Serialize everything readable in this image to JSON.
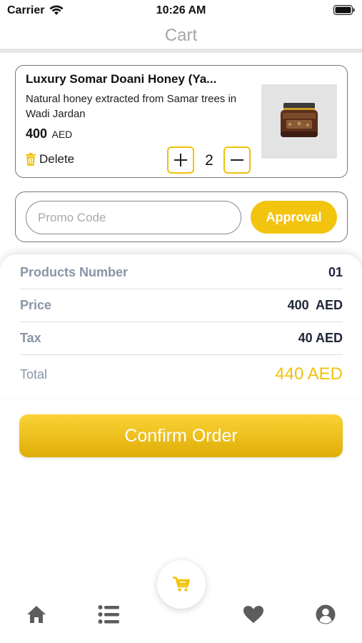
{
  "status_bar": {
    "carrier": "Carrier",
    "time": "10:26 AM"
  },
  "nav": {
    "title": "Cart"
  },
  "product": {
    "name": "Luxury Somar Doani Honey (Ya...",
    "description": "Natural honey extracted from Samar trees in Wadi Jardan",
    "price": "400",
    "currency": "AED",
    "delete_label": "Delete",
    "quantity": "2",
    "image_icon": "honey-jar"
  },
  "promo": {
    "placeholder": "Promo Code",
    "button_label": "Approval"
  },
  "summary": {
    "products_number_label": "Products Number",
    "products_number_value": "01",
    "price_label": "Price",
    "price_value": "400  AED",
    "tax_label": "Tax",
    "tax_value": "40 AED",
    "total_label": "Total",
    "total_value": "440 AED"
  },
  "confirm_button_label": "Confirm Order",
  "tab_bar": {
    "items": [
      "home-icon",
      "list-icon",
      "cart-icon",
      "heart-icon",
      "profile-icon"
    ]
  },
  "colors": {
    "accent": "#f2c40e",
    "label": "#8a94a8",
    "value": "#20263a",
    "icon_gray": "#5d5d5d"
  }
}
